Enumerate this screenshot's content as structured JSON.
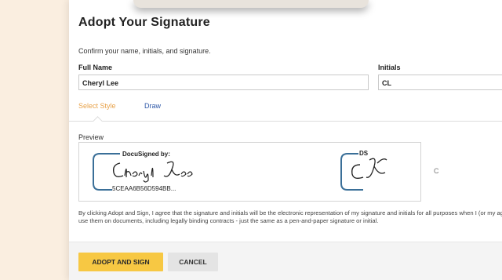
{
  "dialog": {
    "title": "Adopt Your Signature",
    "subtitle": "Confirm your name, initials, and signature.",
    "full_name_label": "Full Name",
    "full_name_value": "Cheryl Lee",
    "initials_label": "Initials",
    "initials_value": "CL"
  },
  "tabs": {
    "select_style": "Select Style",
    "draw": "Draw",
    "active": "Select Style"
  },
  "preview": {
    "label": "Preview",
    "signature_header": "DocuSigned by:",
    "signature_script": "Cheryl Lee",
    "signature_hash": "5CEAA6B56D594BB...",
    "initials_header": "DS",
    "initials_script": "CL",
    "cut_off_text": "C"
  },
  "legal_text": "By clicking Adopt and Sign, I agree that the signature and initials will be the electronic representation of my signature and initials for all purposes when I (or my agent) use them on documents, including legally binding contracts - just the same as a pen-and-paper signature or initial.",
  "buttons": {
    "adopt_and_sign": "ADOPT AND SIGN",
    "cancel": "CANCEL"
  },
  "colors": {
    "page_background": "#faeee0",
    "accent_yellow": "#f7c843",
    "active_tab": "#e8a24a",
    "link_blue": "#2e58a8",
    "docusign_bracket": "#3a6f98"
  }
}
